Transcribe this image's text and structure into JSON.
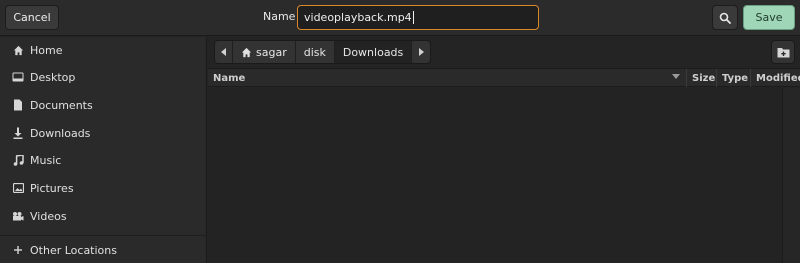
{
  "header": {
    "cancel_label": "Cancel",
    "name_label": "Name",
    "filename_value": "videoplayback.mp4",
    "save_label": "Save"
  },
  "sidebar": {
    "items": [
      {
        "label": "Home",
        "icon": "home-icon"
      },
      {
        "label": "Desktop",
        "icon": "desktop-icon"
      },
      {
        "label": "Documents",
        "icon": "document-icon"
      },
      {
        "label": "Downloads",
        "icon": "download-icon"
      },
      {
        "label": "Music",
        "icon": "music-icon"
      },
      {
        "label": "Pictures",
        "icon": "picture-icon"
      },
      {
        "label": "Videos",
        "icon": "video-icon"
      },
      {
        "label": "Other Locations",
        "icon": "plus-icon"
      }
    ]
  },
  "pathbar": {
    "crumbs": [
      "sagar",
      "disk",
      "Downloads"
    ],
    "active": "Downloads"
  },
  "columns": {
    "name": "Name",
    "size": "Size",
    "type": "Type",
    "modified": "Modified"
  },
  "colors": {
    "accent_focus": "#d8872c",
    "save_button": "#9fd6b7"
  }
}
